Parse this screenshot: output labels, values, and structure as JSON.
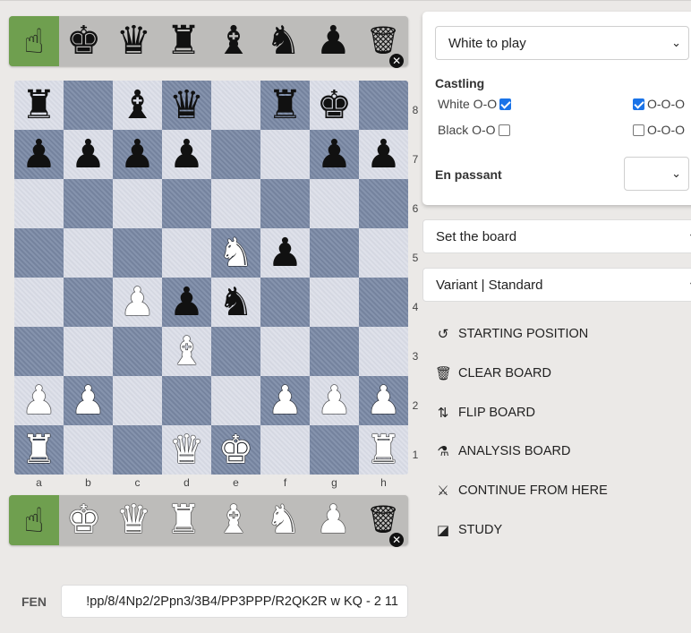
{
  "spare_top": [
    {
      "glyph": "☝",
      "name": "hand-icon"
    },
    {
      "glyph": "♚",
      "name": "black-king-spare"
    },
    {
      "glyph": "♛",
      "name": "black-queen-spare"
    },
    {
      "glyph": "♜",
      "name": "black-rook-spare"
    },
    {
      "glyph": "♝",
      "name": "black-bishop-spare"
    },
    {
      "glyph": "♞",
      "name": "black-knight-spare"
    },
    {
      "glyph": "♟",
      "name": "black-pawn-spare"
    },
    {
      "glyph": "🗑",
      "name": "trash-icon"
    }
  ],
  "spare_bottom": [
    {
      "glyph": "☝",
      "name": "hand-icon"
    },
    {
      "glyph": "♚",
      "name": "white-king-spare"
    },
    {
      "glyph": "♛",
      "name": "white-queen-spare"
    },
    {
      "glyph": "♜",
      "name": "white-rook-spare"
    },
    {
      "glyph": "♝",
      "name": "white-bishop-spare"
    },
    {
      "glyph": "♞",
      "name": "white-knight-spare"
    },
    {
      "glyph": "♟",
      "name": "white-pawn-spare"
    },
    {
      "glyph": "🗑",
      "name": "trash-icon"
    }
  ],
  "board": {
    "rows": [
      [
        "r",
        "",
        "b",
        "q",
        "",
        "r",
        "k",
        ""
      ],
      [
        "p",
        "p",
        "p",
        "p",
        "",
        "",
        "p",
        "p"
      ],
      [
        "",
        "",
        "",
        "",
        "",
        "",
        "",
        ""
      ],
      [
        "",
        "",
        "",
        "",
        "N",
        "p",
        "",
        ""
      ],
      [
        "",
        "",
        "P",
        "p",
        "n",
        "",
        "",
        ""
      ],
      [
        "",
        "",
        "",
        "B",
        "",
        "",
        "",
        ""
      ],
      [
        "P",
        "P",
        "",
        "",
        "",
        "P",
        "P",
        "P"
      ],
      [
        "R",
        "",
        "",
        "Q",
        "K",
        "",
        "",
        "R"
      ]
    ],
    "ranks": [
      "8",
      "7",
      "6",
      "5",
      "4",
      "3",
      "2",
      "1"
    ],
    "files": [
      "a",
      "b",
      "c",
      "d",
      "e",
      "f",
      "g",
      "h"
    ]
  },
  "setup": {
    "turn": "White to play",
    "castling_title": "Castling",
    "white_oo_label": "White O-O",
    "white_oo": true,
    "white_ooo_label": "O-O-O",
    "white_ooo": true,
    "black_oo_label": "Black O-O",
    "black_oo": false,
    "black_ooo_label": "O-O-O",
    "black_ooo": false,
    "en_passant_label": "En passant",
    "en_passant_value": ""
  },
  "set_board_label": "Set the board",
  "variant_label": "Variant | Standard",
  "actions": {
    "starting_position": "STARTING POSITION",
    "clear_board": "CLEAR BOARD",
    "flip_board": "FLIP BOARD",
    "analysis_board": "ANALYSIS BOARD",
    "continue_from_here": "CONTINUE FROM HERE",
    "study": "STUDY"
  },
  "fen": {
    "label": "FEN",
    "value": "!pp/8/4Np2/2Ppn3/3B4/PP3PPP/R2QK2R w KQ - 2 11"
  },
  "colors": {
    "light_square": "#d9dce6",
    "dark_square": "#7b8aa6",
    "active_tool": "#6f9f4f",
    "checkbox_on": "#1a73e8"
  }
}
